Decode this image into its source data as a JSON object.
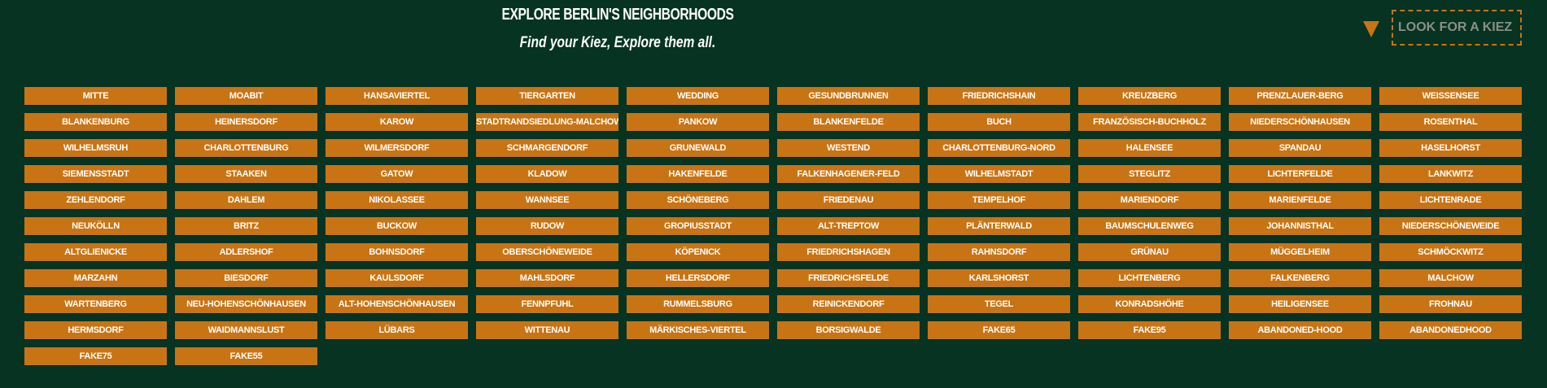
{
  "header": {
    "title": "EXPLORE BERLIN'S NEIGHBORHOODS",
    "subtitle": "Find your Kiez, Explore them all."
  },
  "search": {
    "placeholder": "LOOK FOR A KIEZ",
    "icon": "triangle-down-icon"
  },
  "colors": {
    "background": "#063322",
    "accent": "#c87415",
    "text": "#ffffff"
  },
  "neighborhoods": [
    "MITTE",
    "MOABIT",
    "HANSAVIERTEL",
    "TIERGARTEN",
    "WEDDING",
    "GESUNDBRUNNEN",
    "FRIEDRICHSHAIN",
    "KREUZBERG",
    "PRENZLAUER-BERG",
    "WEISSENSEE",
    "BLANKENBURG",
    "HEINERSDORF",
    "KAROW",
    "STADTRANDSIEDLUNG-MALCHOW",
    "PANKOW",
    "BLANKENFELDE",
    "BUCH",
    "FRANZÖSISCH-BUCHHOLZ",
    "NIEDERSCHÖNHAUSEN",
    "ROSENTHAL",
    "WILHELMSRUH",
    "CHARLOTTENBURG",
    "WILMERSDORF",
    "SCHMARGENDORF",
    "GRUNEWALD",
    "WESTEND",
    "CHARLOTTENBURG-NORD",
    "HALENSEE",
    "SPANDAU",
    "HASELHORST",
    "SIEMENSSTADT",
    "STAAKEN",
    "GATOW",
    "KLADOW",
    "HAKENFELDE",
    "FALKENHAGENER-FELD",
    "WILHELMSTADT",
    "STEGLITZ",
    "LICHTERFELDE",
    "LANKWITZ",
    "ZEHLENDORF",
    "DAHLEM",
    "NIKOLASSEE",
    "WANNSEE",
    "SCHÖNEBERG",
    "FRIEDENAU",
    "TEMPELHOF",
    "MARIENDORF",
    "MARIENFELDE",
    "LICHTENRADE",
    "NEUKÖLLN",
    "BRITZ",
    "BUCKOW",
    "RUDOW",
    "GROPIUSSTADT",
    "ALT-TREPTOW",
    "PLÄNTERWALD",
    "BAUMSCHULENWEG",
    "JOHANNISTHAL",
    "NIEDERSCHÖNEWEIDE",
    "ALTGLIENICKE",
    "ADLERSHOF",
    "BOHNSDORF",
    "OBERSCHÖNEWEIDE",
    "KÖPENICK",
    "FRIEDRICHSHAGEN",
    "RAHNSDORF",
    "GRÜNAU",
    "MÜGGELHEIM",
    "SCHMÖCKWITZ",
    "MARZAHN",
    "BIESDORF",
    "KAULSDORF",
    "MAHLSDORF",
    "HELLERSDORF",
    "FRIEDRICHSFELDE",
    "KARLSHORST",
    "LICHTENBERG",
    "FALKENBERG",
    "MALCHOW",
    "WARTENBERG",
    "NEU-HOHENSCHÖNHAUSEN",
    "ALT-HOHENSCHÖNHAUSEN",
    "FENNPFUHL",
    "RUMMELSBURG",
    "REINICKENDORF",
    "TEGEL",
    "KONRADSHÖHE",
    "HEILIGENSEE",
    "FROHNAU",
    "HERMSDORF",
    "WAIDMANNSLUST",
    "LÜBARS",
    "WITTENAU",
    "MÄRKISCHES-VIERTEL",
    "BORSIGWALDE",
    "FAKE65",
    "FAKE95",
    "ABANDONED-HOOD",
    "ABANDONEDHOOD",
    "FAKE75",
    "FAKE55"
  ]
}
